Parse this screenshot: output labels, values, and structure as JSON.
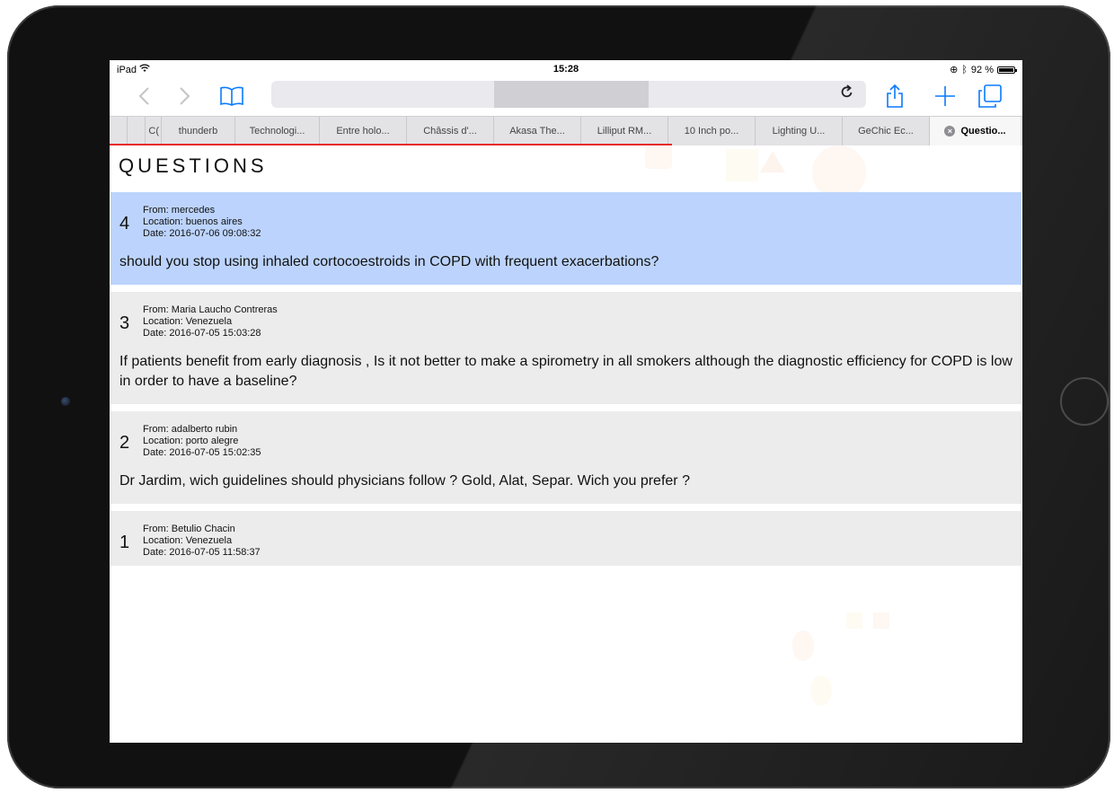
{
  "status_bar": {
    "device": "iPad",
    "time": "15:28",
    "battery": "92 %"
  },
  "toolbar": {
    "back_icon": "‹",
    "forward_icon": "›",
    "reload_icon": "↻",
    "add_icon": "+"
  },
  "tabs": [
    {
      "label": ""
    },
    {
      "label": ""
    },
    {
      "label": "C("
    },
    {
      "label": "thunderb"
    },
    {
      "label": "Technologi..."
    },
    {
      "label": "Entre holo..."
    },
    {
      "label": "Châssis d'..."
    },
    {
      "label": "Akasa The..."
    },
    {
      "label": "Lilliput RM..."
    },
    {
      "label": "10 Inch po..."
    },
    {
      "label": "Lighting U..."
    },
    {
      "label": "GeChic Ec..."
    },
    {
      "label": "Questio...",
      "active": true
    }
  ],
  "page": {
    "title": "QUESTIONS",
    "questions": [
      {
        "number": "4",
        "from": "From: mercedes",
        "location": "Location: buenos aires",
        "date": "Date: 2016-07-06 09:08:32",
        "text": "should you stop using inhaled cortocoestroids in COPD with frequent exacerbations?",
        "highlighted": true
      },
      {
        "number": "3",
        "from": "From: Maria Laucho Contreras",
        "location": "Location: Venezuela",
        "date": "Date: 2016-07-05 15:03:28",
        "text": "If patients benefit from early diagnosis , Is it not better to make a spirometry in all smokers although the diagnostic efficiency for COPD is low in order to have a baseline?",
        "highlighted": false
      },
      {
        "number": "2",
        "from": "From: adalberto rubin",
        "location": "Location: porto alegre",
        "date": "Date: 2016-07-05 15:02:35",
        "text": "Dr Jardim, wich guidelines should physicians follow ? Gold, Alat, Separ. Wich you prefer ?",
        "highlighted": false
      },
      {
        "number": "1",
        "from": "From: Betulio Chacin",
        "location": "Location: Venezuela",
        "date": "Date: 2016-07-05 11:58:37",
        "text": "",
        "highlighted": false
      }
    ]
  },
  "colors": {
    "accent": "#0a7aff",
    "highlight_row": "#bcd4fd",
    "row": "#ececec",
    "progress": "#e62a2a"
  }
}
